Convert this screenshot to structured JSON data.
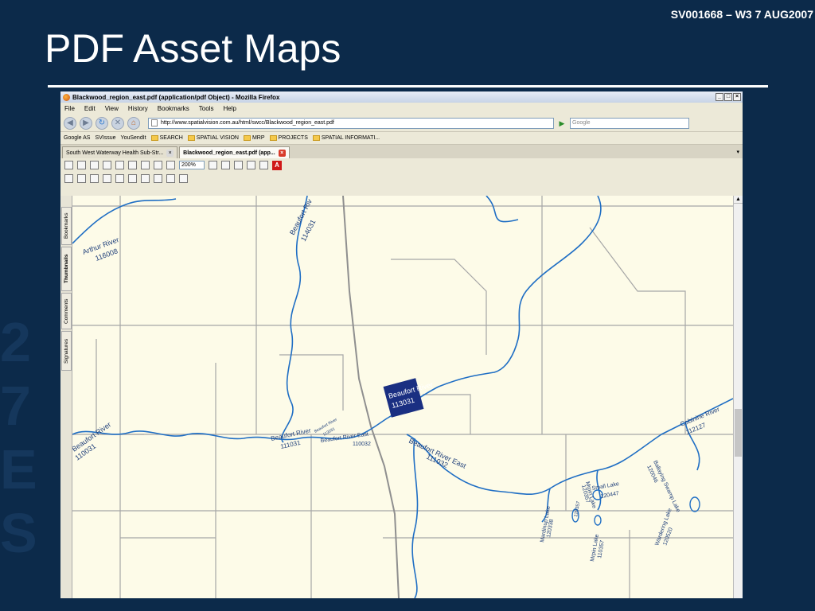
{
  "slide": {
    "tag": "SV001668 – W3 7 AUG2007",
    "title": "PDF Asset Maps"
  },
  "window": {
    "title": "Blackwood_region_east.pdf (application/pdf Object) - Mozilla Firefox",
    "menu": [
      "File",
      "Edit",
      "View",
      "History",
      "Bookmarks",
      "Tools",
      "Help"
    ],
    "url": "http://www.spatialvision.com.au/html/swcc/Blackwood_region_east.pdf",
    "search_placeholder": "Google",
    "bookmarks": [
      "Google AS",
      "SVIssue",
      "YouSendIt",
      "SEARCH",
      "SPATIAL VISION",
      "MRP",
      "PROJECTS",
      "SPATIAL INFORMATI..."
    ],
    "tabs": [
      "South West Waterway Health Sub-Str...",
      "Blackwood_region_east.pdf (app..."
    ],
    "zoom": "200%"
  },
  "side_tabs": [
    "Bookmarks",
    "Thumbnails",
    "Comments",
    "Signatures"
  ],
  "map_labels": {
    "arthur_river": "Arthur River",
    "arthur_code": "116008",
    "beaufort_top": "Beaufort Riv",
    "beaufort_top_code": "114031",
    "beaufort_left": "Beaufort River",
    "beaufort_left_code": "110031",
    "beaufort_mid": "Beaufort River",
    "beaufort_mid_code": "111031",
    "beaufort_small": "Beaufort River",
    "beaufort_small_code": "113031",
    "beaufort_sel": "Beaufort River",
    "beaufort_sel_code": "113031",
    "beaufort_east1": "Beaufort River East",
    "beaufort_east1_code": "110032",
    "beaufort_east2": "Beaufort River East",
    "beaufort_east2_code": "111032",
    "cobinine": "Cobinine River",
    "cobinine_code": "112127",
    "ballaying": "Ballaying Swamp Lake",
    "ballaying_code": "120046",
    "small_lake": "Small Lake",
    "small_lake_code": "120447",
    "wardering": "Wardering Lake",
    "wardering_code": "120520",
    "mardinup": "Mardinup Lake",
    "mardinup_code": "120338",
    "mrpin1": "Mrpin Lake",
    "mrpin1_code": "120357",
    "mrpin2": "Mrpin Lake",
    "mrpin2_code": "110357",
    "code_120357": "120357"
  },
  "colors": {
    "slide_bg": "#0c2a4a",
    "river": "#1f6ec4",
    "road": "#9a9a9a",
    "map_bg": "#fdfbe8",
    "selection": "#1a2f82"
  }
}
